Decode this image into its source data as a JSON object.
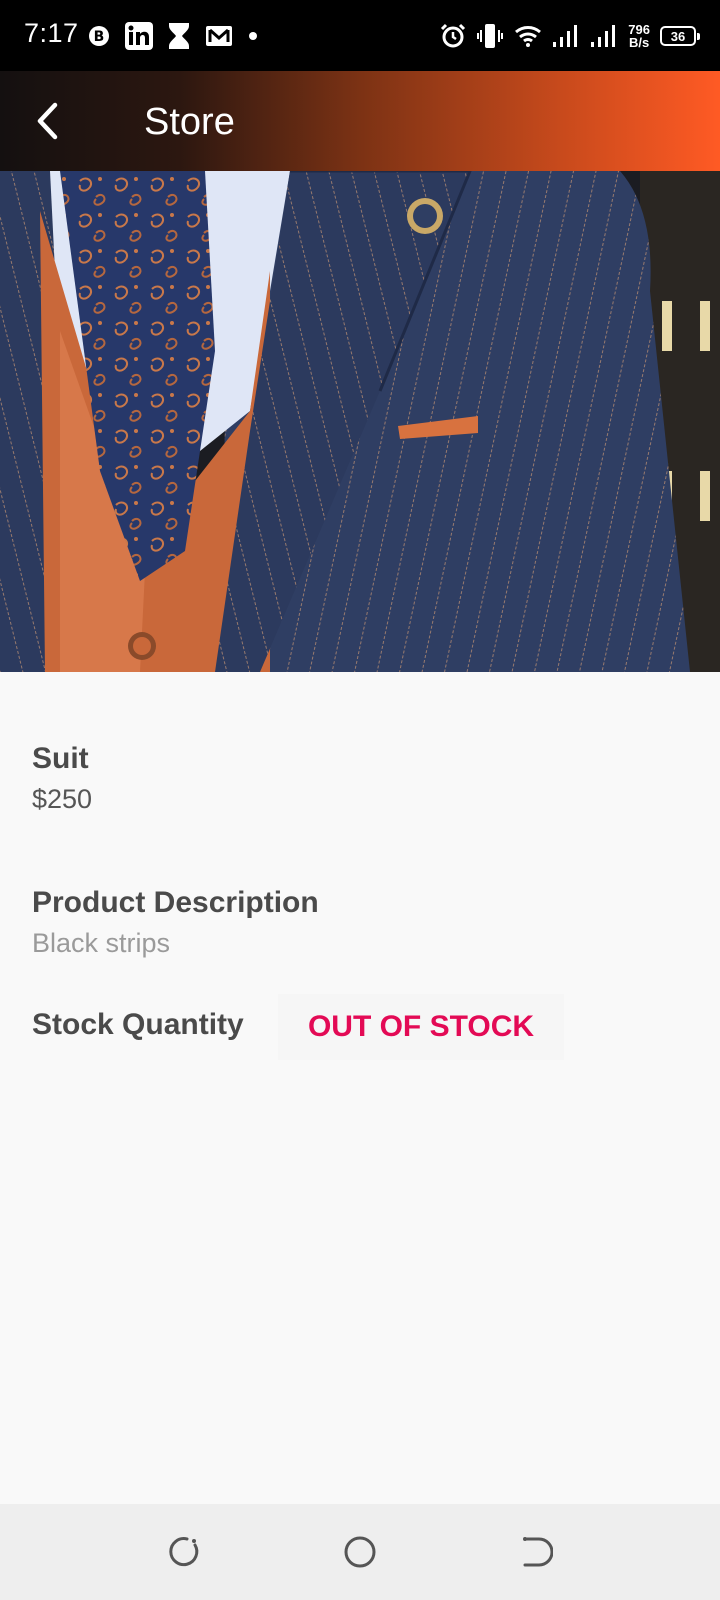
{
  "status_bar": {
    "time": "7:17",
    "left_icons": [
      "b-app-icon",
      "linkedin-icon",
      "hourglass-icon",
      "gmail-icon",
      "dot-icon"
    ],
    "net_speed_value": "796",
    "net_speed_unit": "B/s",
    "battery": "36"
  },
  "app_bar": {
    "title": "Store",
    "back_icon": "chevron-left-icon"
  },
  "product": {
    "image_subject": "navy pinstripe suit with orange vest and paisley tie",
    "name": "Suit",
    "price": "$250",
    "description_label": "Product Description",
    "description": "Black strips",
    "stock_label": "Stock Quantity",
    "stock_status": "OUT OF STOCK"
  },
  "colors": {
    "app_bar_start": "#141010",
    "app_bar_end": "#ff5a24",
    "stock_status": "#e30a55"
  },
  "nav_bar": {
    "icons": [
      "recents-icon",
      "home-icon",
      "back-nav-icon"
    ]
  }
}
